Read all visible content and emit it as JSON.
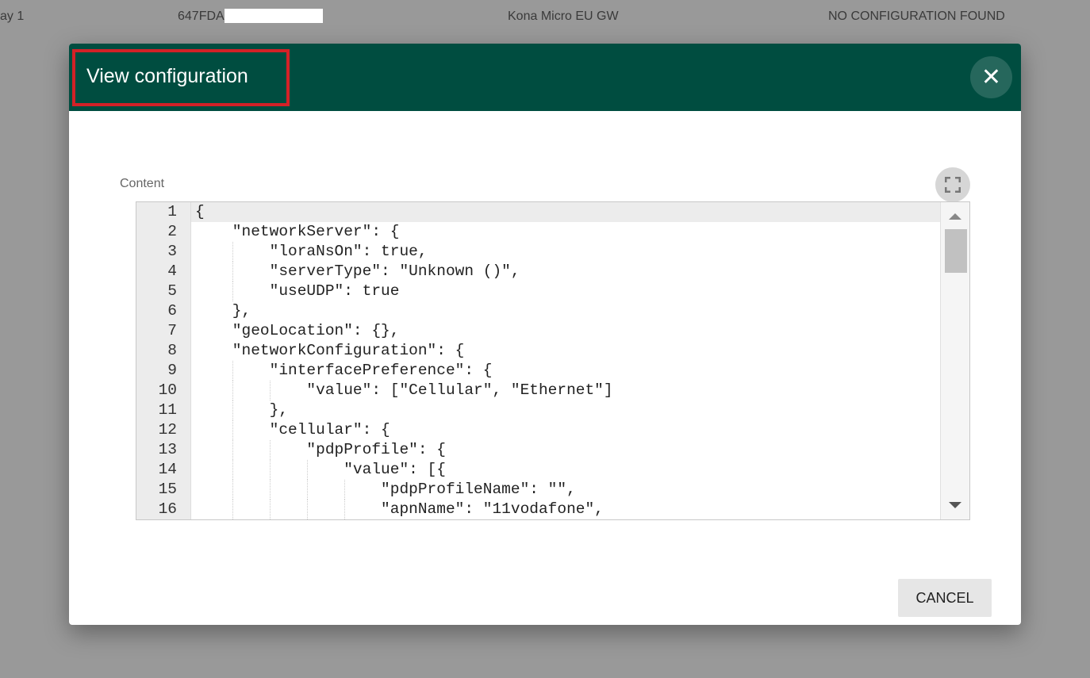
{
  "background_row": {
    "name": "ay 1",
    "id": "647FDA",
    "model": "Kona Micro EU GW",
    "status": "NO CONFIGURATION FOUND"
  },
  "dialog": {
    "title": "View configuration",
    "close_icon": "close-icon",
    "content_label": "Content",
    "fullscreen_icon": "fullscreen-icon",
    "cancel_label": "CANCEL",
    "header_color": "#004d40",
    "highlight_color": "#d42127",
    "active_line": 1,
    "code_lines": [
      "{",
      "    \"networkServer\": {",
      "        \"loraNsOn\": true,",
      "        \"serverType\": \"Unknown ()\",",
      "        \"useUDP\": true",
      "    },",
      "    \"geoLocation\": {},",
      "    \"networkConfiguration\": {",
      "        \"interfacePreference\": {",
      "            \"value\": [\"Cellular\", \"Ethernet\"]",
      "        },",
      "        \"cellular\": {",
      "            \"pdpProfile\": {",
      "                \"value\": [{",
      "                    \"pdpProfileName\": \"\",",
      "                    \"apnName\": \"11vodafone\","
    ]
  }
}
